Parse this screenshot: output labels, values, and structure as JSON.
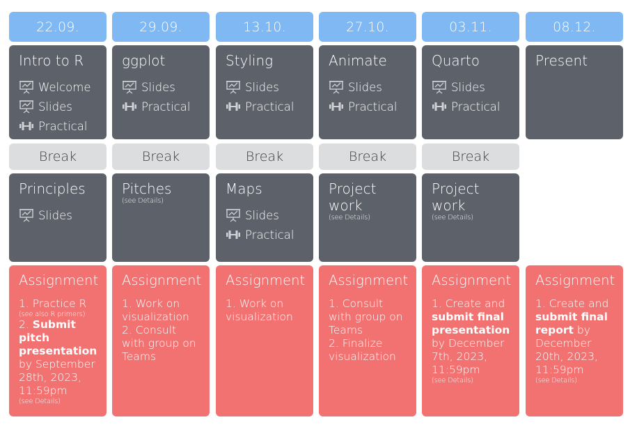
{
  "columns": [
    {
      "date": "22.09.",
      "session1": {
        "title": "Intro to R",
        "items": [
          {
            "icon": "presentation-icon",
            "label": "Welcome"
          },
          {
            "icon": "presentation-icon",
            "label": "Slides"
          },
          {
            "icon": "dumbbell-icon",
            "label": "Practical"
          }
        ]
      },
      "break": "Break",
      "session2": {
        "title": "Principles",
        "details": "",
        "items": [
          {
            "icon": "presentation-icon",
            "label": "Slides"
          }
        ]
      },
      "assignment": {
        "title": "Assignment",
        "lines": [
          {
            "parts": [
              {
                "text": "1. Practice R",
                "style": "normal"
              }
            ]
          },
          {
            "parts": [
              {
                "text": "(see also R primers)",
                "style": "small"
              }
            ]
          },
          {
            "parts": [
              {
                "text": "2. ",
                "style": "normal"
              },
              {
                "text": "Submit pitch presentation",
                "style": "bold"
              },
              {
                "text": " by September 28th, 2023, 11:59pm",
                "style": "normal"
              }
            ]
          },
          {
            "parts": [
              {
                "text": "(see Details)",
                "style": "small"
              }
            ]
          }
        ]
      }
    },
    {
      "date": "29.09.",
      "session1": {
        "title": "ggplot",
        "items": [
          {
            "icon": "presentation-icon",
            "label": "Slides"
          },
          {
            "icon": "dumbbell-icon",
            "label": "Practical"
          }
        ]
      },
      "break": "Break",
      "session2": {
        "title": "Pitches",
        "details": "(see Details)",
        "items": []
      },
      "assignment": {
        "title": "Assignment",
        "lines": [
          {
            "parts": [
              {
                "text": "1. Work on visualization",
                "style": "normal"
              }
            ]
          },
          {
            "parts": [
              {
                "text": "2. Consult with group on Teams",
                "style": "normal"
              }
            ]
          }
        ]
      }
    },
    {
      "date": "13.10.",
      "session1": {
        "title": "Styling",
        "items": [
          {
            "icon": "presentation-icon",
            "label": "Slides"
          },
          {
            "icon": "dumbbell-icon",
            "label": "Practical"
          }
        ]
      },
      "break": "Break",
      "session2": {
        "title": "Maps",
        "details": "",
        "items": [
          {
            "icon": "presentation-icon",
            "label": "Slides"
          },
          {
            "icon": "dumbbell-icon",
            "label": "Practical"
          }
        ]
      },
      "assignment": {
        "title": "Assignment",
        "lines": [
          {
            "parts": [
              {
                "text": "1. Work on visualization",
                "style": "normal"
              }
            ]
          }
        ]
      }
    },
    {
      "date": "27.10.",
      "session1": {
        "title": "Animate",
        "items": [
          {
            "icon": "presentation-icon",
            "label": "Slides"
          },
          {
            "icon": "dumbbell-icon",
            "label": "Practical"
          }
        ]
      },
      "break": "Break",
      "session2": {
        "title": "Project work",
        "details": "(see Details)",
        "items": []
      },
      "assignment": {
        "title": "Assignment",
        "lines": [
          {
            "parts": [
              {
                "text": "1. Consult with group on Teams",
                "style": "normal"
              }
            ]
          },
          {
            "parts": [
              {
                "text": "2. Finalize visualization",
                "style": "normal"
              }
            ]
          }
        ]
      }
    },
    {
      "date": "03.11.",
      "session1": {
        "title": "Quarto",
        "items": [
          {
            "icon": "presentation-icon",
            "label": "Slides"
          },
          {
            "icon": "dumbbell-icon",
            "label": "Practical"
          }
        ]
      },
      "break": "Break",
      "session2": {
        "title": "Project work",
        "details": "(see Details)",
        "items": []
      },
      "assignment": {
        "title": "Assignment",
        "lines": [
          {
            "parts": [
              {
                "text": "1. Create and ",
                "style": "normal"
              },
              {
                "text": "submit final presentation",
                "style": "bold"
              },
              {
                "text": " by December 7th, 2023, 11:59pm",
                "style": "normal"
              }
            ]
          },
          {
            "parts": [
              {
                "text": "(see Details)",
                "style": "small"
              }
            ]
          }
        ]
      }
    },
    {
      "date": "08.12.",
      "session1": {
        "title": "Present",
        "items": []
      },
      "break": "",
      "session2": null,
      "assignment": {
        "title": "Assignment",
        "lines": [
          {
            "parts": [
              {
                "text": "1. Create and ",
                "style": "normal"
              },
              {
                "text": "submit final report",
                "style": "bold"
              },
              {
                "text": " by December 20th, 2023, 11:59pm",
                "style": "normal"
              }
            ]
          },
          {
            "parts": [
              {
                "text": "(see Details)",
                "style": "small"
              }
            ]
          }
        ]
      }
    }
  ],
  "colors": {
    "date_bg": "#7fb8f2",
    "session_bg": "#5d6169",
    "break_bg": "#dcdddf",
    "assignment_bg": "#f27272"
  }
}
